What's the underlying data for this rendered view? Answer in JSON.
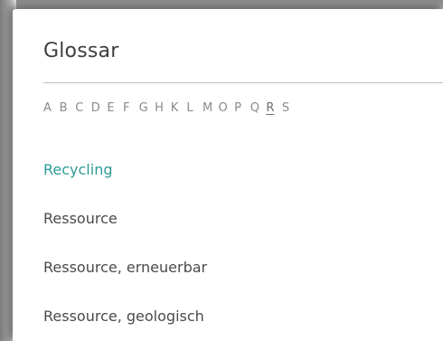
{
  "glossary": {
    "title": "Glossar",
    "letters": [
      "A",
      "B",
      "C",
      "D",
      "E",
      "F",
      "G",
      "H",
      "K",
      "L",
      "M",
      "O",
      "P",
      "Q",
      "R",
      "S"
    ],
    "active_letter": "R",
    "entries": [
      {
        "label": "Recycling",
        "highlighted": true
      },
      {
        "label": "Ressource",
        "highlighted": false
      },
      {
        "label": "Ressource, erneuerbar",
        "highlighted": false
      },
      {
        "label": "Ressource, geologisch",
        "highlighted": false
      }
    ]
  },
  "colors": {
    "accent": "#2e9a96",
    "text": "#4a4a4a",
    "letter": "#8a8a8a"
  }
}
